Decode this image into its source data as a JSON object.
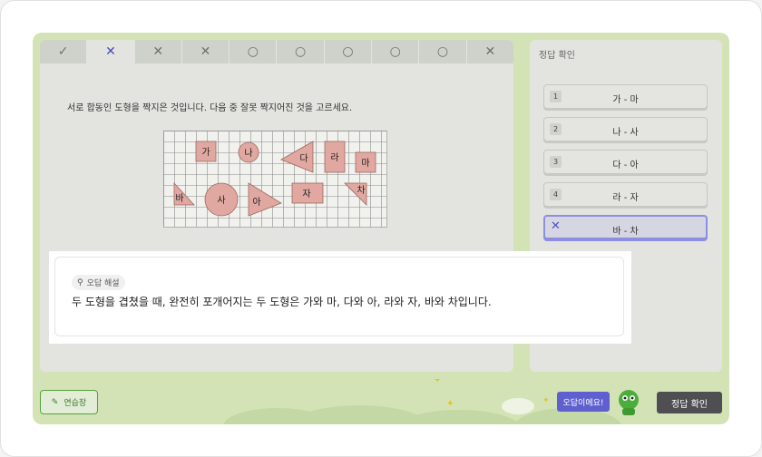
{
  "tabs": [
    {
      "mark": "✓",
      "state": "correct"
    },
    {
      "mark": "✕",
      "state": "active"
    },
    {
      "mark": "✕",
      "state": "wrong"
    },
    {
      "mark": "✕",
      "state": "wrong"
    },
    {
      "mark": "○",
      "state": "unanswered"
    },
    {
      "mark": "○",
      "state": "unanswered"
    },
    {
      "mark": "○",
      "state": "unanswered"
    },
    {
      "mark": "○",
      "state": "unanswered"
    },
    {
      "mark": "○",
      "state": "unanswered"
    },
    {
      "mark": "✕",
      "state": "wrong"
    }
  ],
  "question": {
    "text": "서로 합동인 도형을 짝지은 것입니다. 다음 중 잘못 짝지어진 것을 고르세요."
  },
  "figure": {
    "labels": [
      "가",
      "나",
      "다",
      "라",
      "마",
      "바",
      "사",
      "아",
      "자",
      "차"
    ]
  },
  "answer_panel": {
    "title": "정답 확인",
    "options": [
      {
        "num": "1",
        "label": "가 - 마"
      },
      {
        "num": "2",
        "label": "나 - 사"
      },
      {
        "num": "3",
        "label": "다 - 아"
      },
      {
        "num": "4",
        "label": "라 - 자"
      },
      {
        "num": "✕",
        "label": "바 - 차",
        "selected": true
      }
    ]
  },
  "bottom": {
    "memo_label": "연습장",
    "wrong_label": "오답이에요!",
    "confirm_label": "정답 확인"
  },
  "explanation": {
    "chip": "오답 해설",
    "text": "두 도형을 겹쳤을 때, 완전히 포개어지는 두 도형은 가와 마, 다와 아, 라와 자, 바와 차입니다."
  },
  "colors": {
    "accent": "#5f5fd0",
    "green": "#56a23c",
    "shape_fill": "#e0a8a0"
  }
}
